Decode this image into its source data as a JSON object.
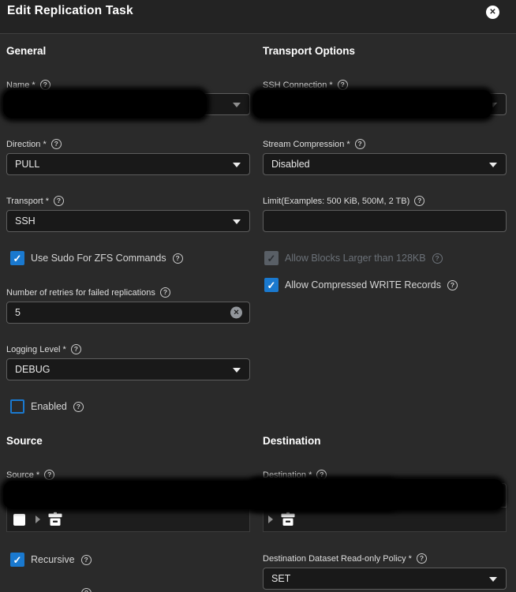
{
  "titlebar": {
    "title": "Edit Replication Task"
  },
  "glyphs": {
    "close": "✕",
    "check": "✓",
    "help": "?",
    "clear": "✕"
  },
  "sections": {
    "general": "General",
    "transport_options": "Transport Options",
    "source": "Source",
    "destination": "Destination"
  },
  "fields": {
    "name": {
      "label": "Name *",
      "redacted": true
    },
    "ssh_connection": {
      "label": "SSH Connection *",
      "redacted": true
    },
    "direction": {
      "label": "Direction *",
      "value": "PULL"
    },
    "stream_compression": {
      "label": "Stream Compression *",
      "value": "Disabled"
    },
    "transport": {
      "label": "Transport *",
      "value": "SSH"
    },
    "limit": {
      "label": "Limit(Examples: 500 KiB, 500M, 2 TB)",
      "value": ""
    },
    "use_sudo": {
      "label": "Use Sudo For ZFS Commands",
      "checked": true
    },
    "allow_blocks": {
      "label": "Allow Blocks Larger than 128KB",
      "checked": true,
      "disabled": true
    },
    "allow_compressed": {
      "label": "Allow Compressed WRITE Records",
      "checked": true
    },
    "retries": {
      "label": "Number of retries for failed replications",
      "value": "5"
    },
    "logging_level": {
      "label": "Logging Level *",
      "value": "DEBUG"
    },
    "enabled": {
      "label": "Enabled",
      "checked": false
    },
    "source": {
      "label": "Source *",
      "redacted": true
    },
    "destination": {
      "label": "Destination *",
      "redacted": true
    },
    "recursive": {
      "label": "Recursive",
      "checked": true
    },
    "readonly_policy": {
      "label": "Destination Dataset Read-only Policy *",
      "value": "SET"
    }
  },
  "colors": {
    "accent_blue": "#1a79cf",
    "body_bg": "#2a2a2a",
    "header_bg": "#232323",
    "input_bg": "#191919",
    "redaction": "#000000"
  }
}
